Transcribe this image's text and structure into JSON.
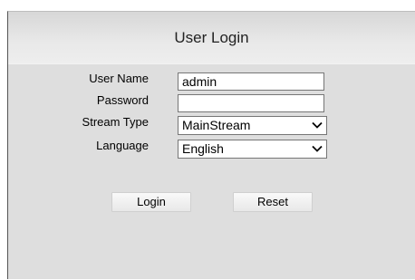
{
  "login": {
    "title": "User Login",
    "username_label": "User Name",
    "username_value": "admin",
    "password_label": "Password",
    "password_value": "",
    "stream_type_label": "Stream Type",
    "stream_type_value": "MainStream",
    "language_label": "Language",
    "language_value": "English",
    "login_button": "Login",
    "reset_button": "Reset"
  },
  "icons": {
    "dropdown": "chevron-down-icon"
  },
  "colors": {
    "panel_bg": "#dedede",
    "header_bg": "#e6e6e6",
    "field_border": "#767676"
  }
}
